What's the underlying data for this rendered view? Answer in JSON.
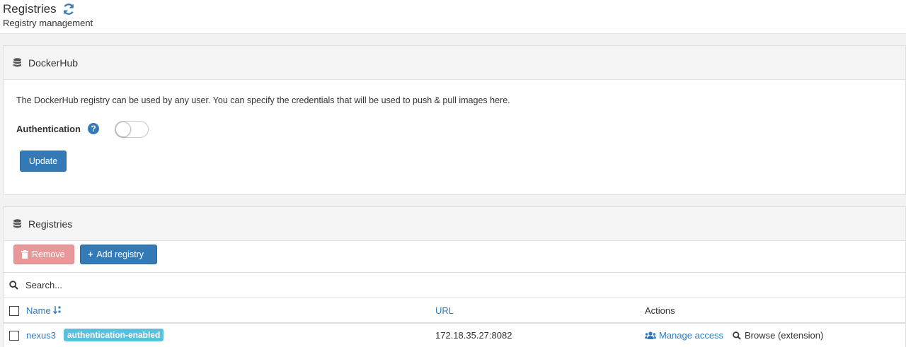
{
  "header": {
    "title": "Registries",
    "subtitle": "Registry management"
  },
  "dockerhub": {
    "title": "DockerHub",
    "description": "The DockerHub registry can be used by any user. You can specify the credentials that will be used to push & pull images here.",
    "auth_label": "Authentication",
    "help_glyph": "?",
    "auth_enabled": false,
    "update_label": "Update"
  },
  "registries": {
    "title": "Registries",
    "remove_label": "Remove",
    "add_label": "Add registry",
    "add_glyph": "+",
    "search_placeholder": "Search...",
    "columns": {
      "name": "Name",
      "url": "URL",
      "actions": "Actions"
    },
    "rows": [
      {
        "name": "nexus3",
        "badge": "authentication-enabled",
        "url": "172.18.35.27:8082",
        "manage_label": "Manage access",
        "browse_label": "Browse (extension)"
      }
    ]
  },
  "colors": {
    "primary": "#337ab7",
    "danger_disabled": "#e89898",
    "info_badge": "#5bc0de"
  }
}
